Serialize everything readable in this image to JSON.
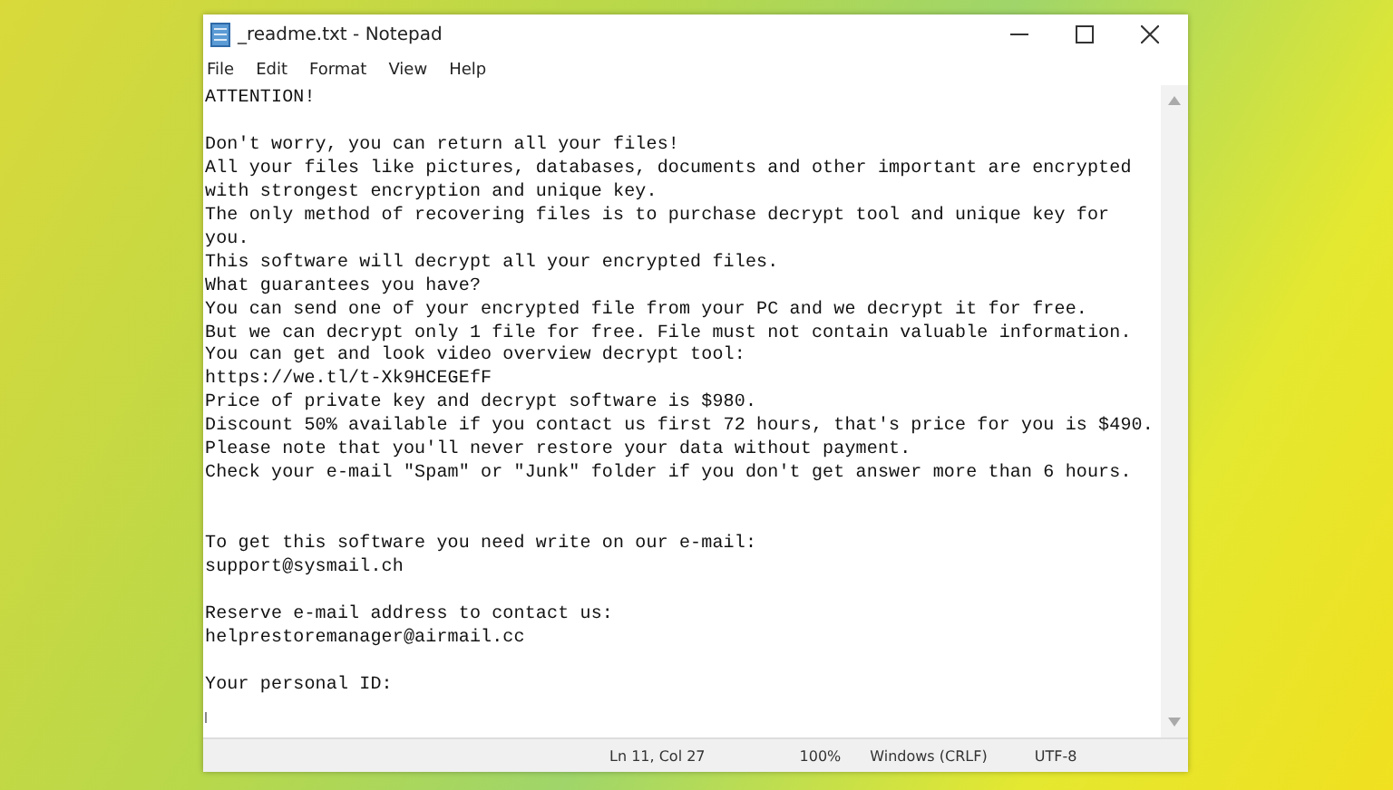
{
  "window": {
    "title": "_readme.txt - Notepad"
  },
  "menu": [
    "File",
    "Edit",
    "Format",
    "View",
    "Help"
  ],
  "document": {
    "lines": [
      {
        "kind": "text",
        "text": "ATTENTION!"
      },
      {
        "kind": "blank"
      },
      {
        "kind": "text",
        "text": "Don't worry, you can return all your files!"
      },
      {
        "kind": "text",
        "text": "All your files like pictures, databases, documents and other important are encrypted"
      },
      {
        "kind": "text",
        "text": "with strongest encryption and unique key."
      },
      {
        "kind": "text",
        "text": "The only method of recovering files is to purchase decrypt tool and unique key for"
      },
      {
        "kind": "text",
        "text": "you."
      },
      {
        "kind": "text",
        "text": "This software will decrypt all your encrypted files."
      },
      {
        "kind": "text",
        "text": "What guarantees you have?"
      },
      {
        "kind": "text",
        "text": "You can send one of your encrypted file from your PC and we decrypt it for free."
      },
      {
        "kind": "text",
        "text": "But we can decrypt only 1 file for free. File must not contain valuable information."
      },
      {
        "kind": "text",
        "text": "You can get and look video overview decrypt tool:"
      },
      {
        "kind": "text",
        "text": "https://we.tl/t-Xk9HCEGEfF"
      },
      {
        "kind": "text",
        "text": "Price of private key and decrypt software is $980."
      },
      {
        "kind": "text",
        "text": "Discount 50% available if you contact us first 72 hours, that's price for you is $490."
      },
      {
        "kind": "text",
        "text": "Please note that you'll never restore your data without payment."
      },
      {
        "kind": "text",
        "text": "Check your e-mail \"Spam\" or \"Junk\" folder if you don't get answer more than 6 hours."
      },
      {
        "kind": "blank"
      },
      {
        "kind": "blank"
      },
      {
        "kind": "text",
        "text": "To get this software you need write on our e-mail:"
      },
      {
        "kind": "text",
        "text": "support@sysmail.ch"
      },
      {
        "kind": "blank"
      },
      {
        "kind": "text",
        "text": "Reserve e-mail address to contact us:"
      },
      {
        "kind": "text",
        "text": "helprestoremanager@airmail.cc"
      },
      {
        "kind": "blank"
      },
      {
        "kind": "text",
        "text": "Your personal ID:"
      }
    ]
  },
  "status_bar": [
    "Ln 11, Col 27",
    "100%",
    "Windows (CRLF)",
    "UTF-8"
  ]
}
